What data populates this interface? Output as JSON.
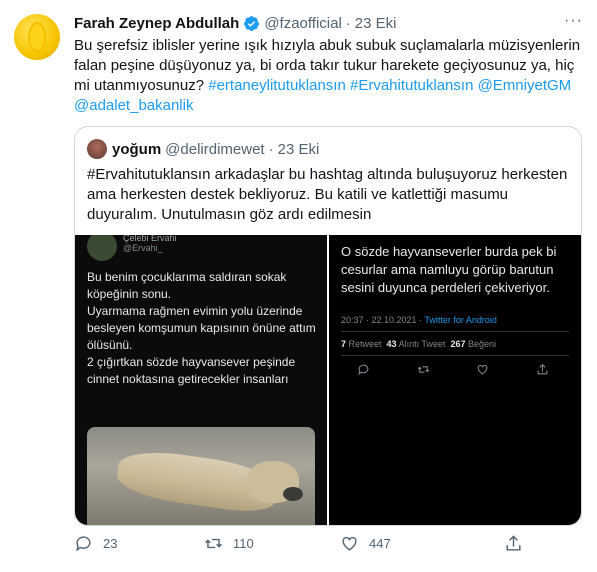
{
  "tweet": {
    "name": "Farah Zeynep Abdullah",
    "handle": "@fzaofficial",
    "separator": "·",
    "date": "23 Eki",
    "more": "···",
    "text_plain": "Bu şerefsiz iblisler yerine ışık hızıyla abuk subuk suçlamalarla müzisyenlerin falan peşine düşüyonuz ya, bi orda takır tukur harekete geçiyosunuz ya, hiç mi utanmıyosunuz? ",
    "hashtag1": "#ertaneylitutuklansın",
    "hashtag2": "#Ervahitutuklansın",
    "mention1": "@EmniyetGM",
    "mention2": "@adalet_bakanlik"
  },
  "quote": {
    "name": "yoğum",
    "handle": "@delirdimewet",
    "separator": "·",
    "date": "23 Eki",
    "text": "#Ervahitutuklansın arkadaşlar bu hashtag altında buluşuyoruz herkesten ama herkesten destek bekliyoruz. Bu katili ve katlettiği masumu duyuralım. Unutulmasın göz ardı edilmesin",
    "media_left": {
      "name": "Çelebi Ervahi",
      "handle": "@Ervahi_",
      "text": "Bu benim çocuklarıma saldıran sokak köpeğinin sonu.\nUyarmama rağmen evimin yolu üzerinde besleyen komşumun kapısının önüne attım ölüsünü.\n2 çığırtkan sözde hayvansever peşinde cinnet noktasına getirecekler insanları"
    },
    "media_right": {
      "text": "O sözde hayvanseverler burda pek bi cesurlar ama namluyu görüp barutun sesini duyunca perdeleri çekiveriyor.",
      "meta_time": "20:37 · 22.10.2021 · ",
      "meta_source": "Twitter for Android",
      "retweets_num": "7",
      "retweets_label": " Retweet  ",
      "quotes_num": "43",
      "quotes_label": " Alıntı Tweet  ",
      "likes_num": "267",
      "likes_label": " Beğeni"
    }
  },
  "actions": {
    "replies": "23",
    "retweets": "110",
    "likes": "447"
  },
  "colors": {
    "link": "#1d9bf0",
    "secondary_text": "#536471",
    "border": "#cfd9de"
  }
}
